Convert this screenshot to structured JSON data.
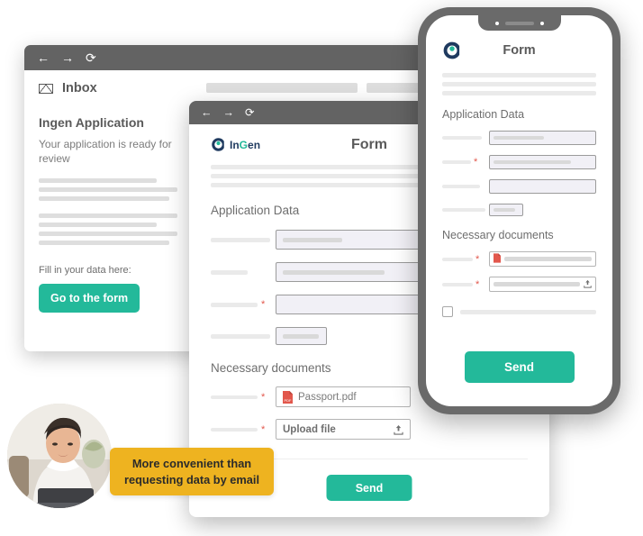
{
  "mail_window": {
    "nav": {
      "back": "←",
      "forward": "→",
      "reload": "⟳"
    },
    "inbox_label": "Inbox",
    "mail_title": "Ingen Application",
    "mail_subtitle": "Your application is ready for review",
    "fill_label": "Fill in your data here:",
    "cta_label": "Go to the form"
  },
  "form_window": {
    "nav": {
      "back": "←",
      "forward": "→",
      "reload": "⟳"
    },
    "logo": {
      "in": "In",
      "g": "G",
      "en": "en"
    },
    "title": "Form",
    "section_application": "Application Data",
    "section_documents": "Necessary documents",
    "required_mark": "*",
    "documents": [
      {
        "name": "Passport.pdf",
        "icon": "pdf-file-icon",
        "required": true
      },
      {
        "name": "Upload file",
        "icon": "upload-icon",
        "required": true
      }
    ],
    "send_label": "Send"
  },
  "phone": {
    "title": "Form",
    "section_application": "Application Data",
    "section_documents": "Necessary documents",
    "required_mark": "*",
    "send_label": "Send"
  },
  "tooltip": {
    "text": "More convenient than requesting data by email"
  },
  "colors": {
    "accent_green": "#23b99a",
    "tooltip_yellow": "#eeb320",
    "required_red": "#e2574c",
    "chrome_gray": "#636363",
    "logo_navy": "#1f3a5f"
  }
}
